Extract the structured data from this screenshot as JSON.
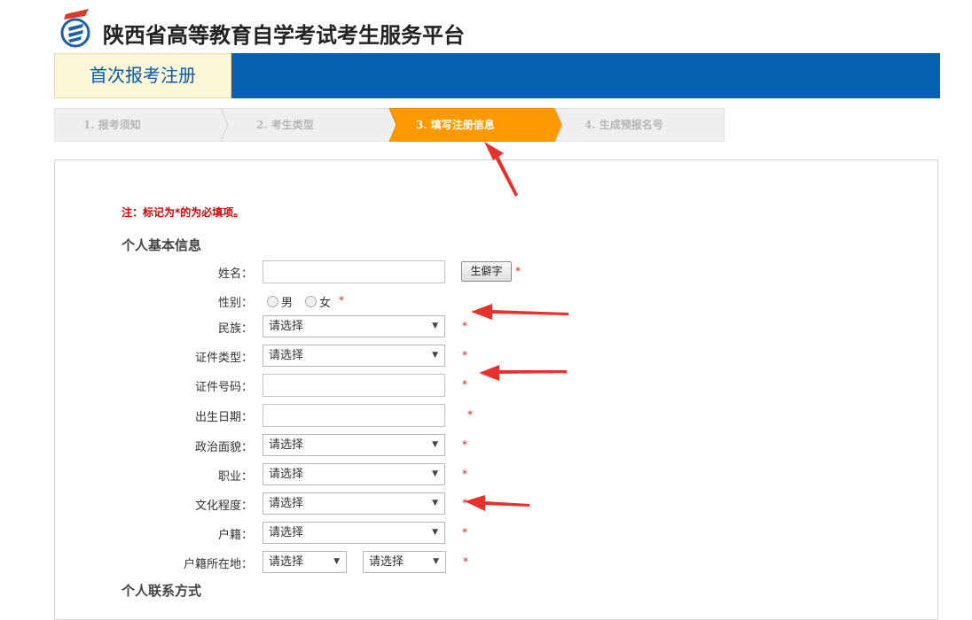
{
  "header": {
    "site_title": "陕西省高等教育自学考试考生服务平台",
    "nav_tab": "首次报考注册",
    "brand_color": "#0860b0"
  },
  "steps": [
    {
      "label": "1. 报考须知",
      "active": false
    },
    {
      "label": "2. 考生类型",
      "active": false
    },
    {
      "label": "3. 填写注册信息",
      "active": true
    },
    {
      "label": "4. 生成预报名号",
      "active": false
    }
  ],
  "form": {
    "note": "注：标记为*的为必填项。",
    "section_basic": "个人基本信息",
    "section_contact": "个人联系方式",
    "required_mark": "*",
    "name": {
      "label": "姓名：",
      "value": "",
      "button": "生僻字"
    },
    "gender": {
      "label": "性别：",
      "options": [
        "男",
        "女"
      ]
    },
    "ethnicity": {
      "label": "民族：",
      "value": "请选择"
    },
    "id_type": {
      "label": "证件类型：",
      "value": "请选择"
    },
    "id_number": {
      "label": "证件号码：",
      "value": ""
    },
    "birth_date": {
      "label": "出生日期：",
      "value": ""
    },
    "political": {
      "label": "政治面貌：",
      "value": "请选择"
    },
    "occupation": {
      "label": "职业：",
      "value": "请选择"
    },
    "education": {
      "label": "文化程度：",
      "value": "请选择"
    },
    "household": {
      "label": "户籍：",
      "value": "请选择"
    },
    "household_location": {
      "label": "户籍所在地：",
      "value_1": "请选择",
      "value_2": "请选择"
    }
  },
  "icons": {
    "logo": "exam-platform-logo-icon",
    "select_arrow": "triangle-down-icon",
    "annotation": "red-arrow-icon"
  },
  "colors": {
    "step_active": "#ff9900",
    "step_inactive": "#efefef",
    "required": "#e02020",
    "annotation_arrow": "#e8302c"
  }
}
